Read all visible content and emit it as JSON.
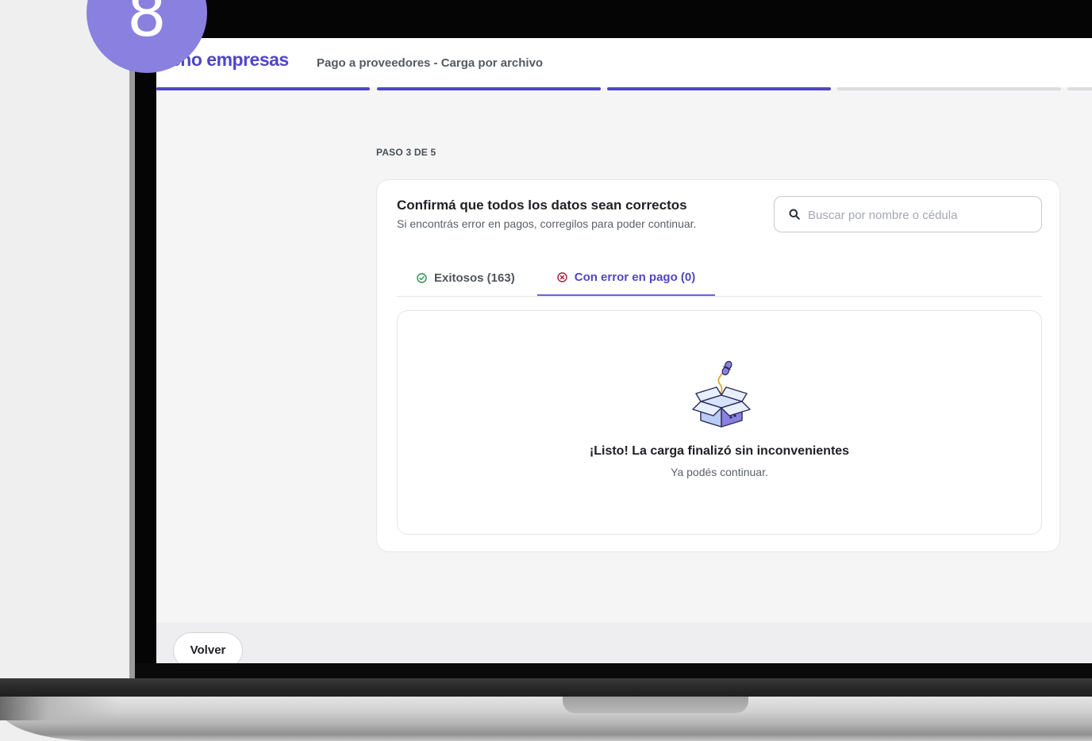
{
  "step_badge": "8",
  "app": {
    "brand": "eno empresas",
    "title": "Pago a proveedores - Carga por archivo"
  },
  "progress": {
    "completed_steps": 3,
    "total_steps": 5
  },
  "step_label": "PASO 3 DE 5",
  "card": {
    "title": "Confirmá que todos los datos sean correctos",
    "subtitle": "Si encontrás error en pagos, corregilos para poder continuar."
  },
  "search": {
    "placeholder": "Buscar por nombre o cédula",
    "value": ""
  },
  "tabs": [
    {
      "label": "Exitosos (163)",
      "icon": "check-circle-icon",
      "active": false
    },
    {
      "label": "Con error en pago (0)",
      "icon": "x-circle-icon",
      "active": true
    }
  ],
  "empty_state": {
    "icon": "open-box-illustration",
    "title": "¡Listo! La carga finalizó sin inconvenientes",
    "subtitle": "Ya podés continuar."
  },
  "footer": {
    "back_label": "Volver"
  },
  "colors": {
    "brand": "#4f46c8",
    "progress_done": "#5046c4",
    "progress_todo": "#dcdce0",
    "badge": "#8a80e0",
    "success_icon": "#2f8f4e",
    "error_icon": "#a0203a"
  }
}
